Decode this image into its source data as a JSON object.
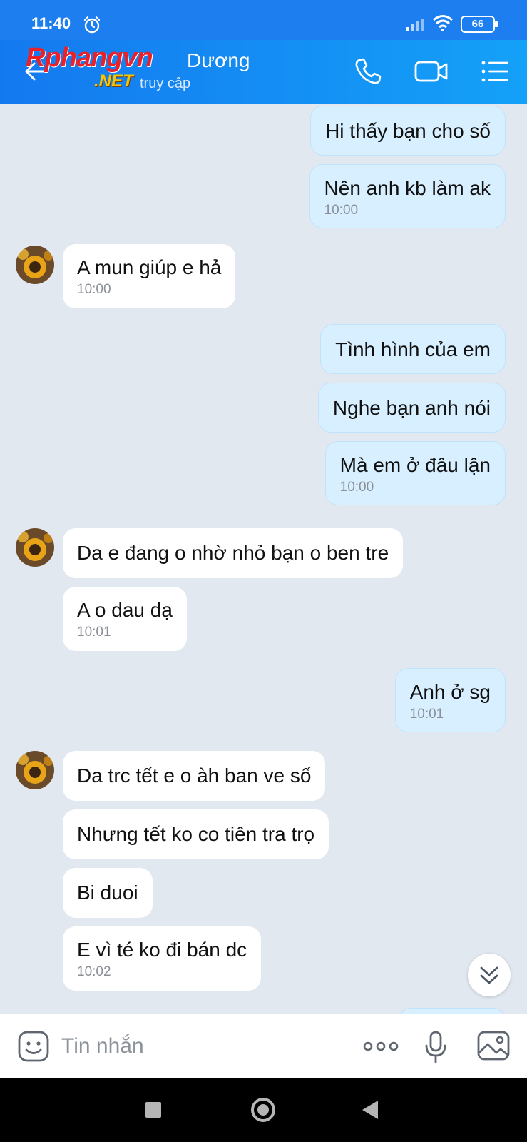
{
  "status_bar": {
    "time": "11:40",
    "battery": "66"
  },
  "header": {
    "name": "Dương",
    "status": "truy cập",
    "watermark_main": "Rphangvn",
    "watermark_sub": ".NET"
  },
  "messages": [
    {
      "side": "sent",
      "text": "Hi thấy bạn cho số",
      "time": ""
    },
    {
      "side": "sent",
      "text": "Nên anh kb làm ak",
      "time": "10:00"
    },
    {
      "side": "recv",
      "text": "A mun giúp e hả",
      "time": "10:00",
      "avatar": true
    },
    {
      "side": "sent",
      "text": "Tình hình của em",
      "time": ""
    },
    {
      "side": "sent",
      "text": "Nghe bạn anh nói",
      "time": ""
    },
    {
      "side": "sent",
      "text": "Mà em ở đâu lận",
      "time": "10:00"
    },
    {
      "side": "recv",
      "text": "Da e đang o nhờ nhỏ bạn o ben tre",
      "time": "",
      "avatar": true
    },
    {
      "side": "recv",
      "text": "A o dau dạ",
      "time": "10:01"
    },
    {
      "side": "sent",
      "text": "Anh ở sg",
      "time": "10:01"
    },
    {
      "side": "recv",
      "text": "Da trc tết e o àh ban  ve số",
      "time": "",
      "avatar": true
    },
    {
      "side": "recv",
      "text": "Nhưng tết ko co tiên tra trọ",
      "time": ""
    },
    {
      "side": "recv",
      "text": "Bi duoi",
      "time": ""
    },
    {
      "side": "recv",
      "text": "E vì té  ko đi bán  dc",
      "time": "10:02"
    }
  ],
  "input": {
    "placeholder": "Tin nhắn"
  },
  "colors": {
    "header": "#1479ef",
    "sent_bubble": "#d7efff",
    "recv_bubble": "#ffffff",
    "background": "#e2e8f0"
  }
}
